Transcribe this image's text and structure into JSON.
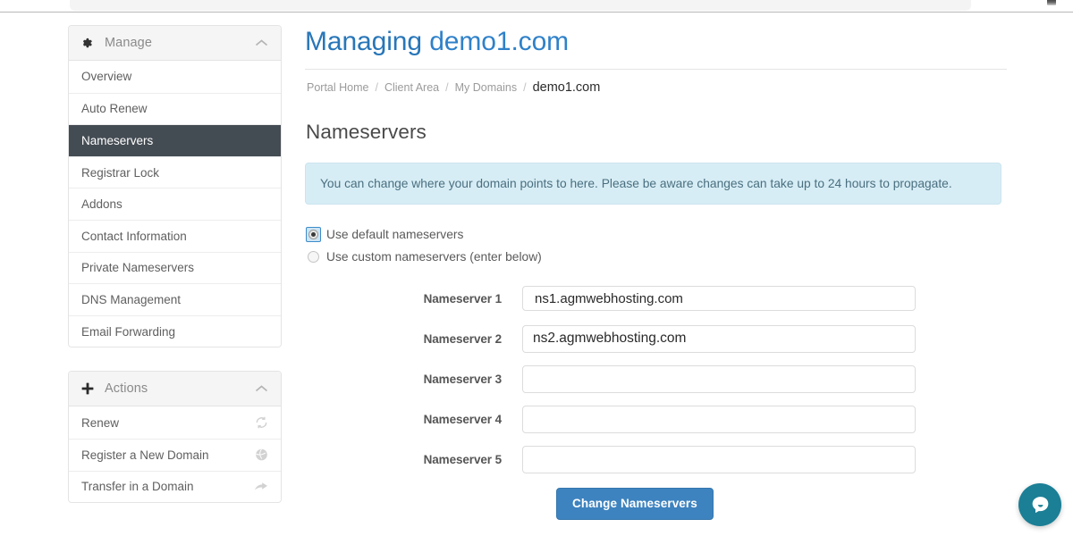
{
  "window": {
    "navbar_remnant": "",
    "top_right_glyph_icon": "cut-off-icon"
  },
  "sidebar": {
    "panels": [
      {
        "title": "Manage",
        "icon": "gear-icon",
        "collapse_icon": "chevron-up-icon",
        "items": [
          {
            "label": "Overview",
            "active": false,
            "icon": ""
          },
          {
            "label": "Auto Renew",
            "active": false,
            "icon": ""
          },
          {
            "label": "Nameservers",
            "active": true,
            "icon": ""
          },
          {
            "label": "Registrar Lock",
            "active": false,
            "icon": ""
          },
          {
            "label": "Addons",
            "active": false,
            "icon": ""
          },
          {
            "label": "Contact Information",
            "active": false,
            "icon": ""
          },
          {
            "label": "Private Nameservers",
            "active": false,
            "icon": ""
          },
          {
            "label": "DNS Management",
            "active": false,
            "icon": ""
          },
          {
            "label": "Email Forwarding",
            "active": false,
            "icon": ""
          }
        ]
      },
      {
        "title": "Actions",
        "icon": "plus-icon",
        "collapse_icon": "chevron-up-icon",
        "items": [
          {
            "label": "Renew",
            "active": false,
            "icon": "refresh-icon"
          },
          {
            "label": "Register a New Domain",
            "active": false,
            "icon": "globe-icon"
          },
          {
            "label": "Transfer in a Domain",
            "active": false,
            "icon": "arrow-right-curve-icon"
          }
        ]
      }
    ]
  },
  "main": {
    "title_prefix": "Managing",
    "title_domain": "demo1.com",
    "breadcrumb": [
      {
        "label": "Portal Home",
        "current": false
      },
      {
        "label": "Client Area",
        "current": false
      },
      {
        "label": "My Domains",
        "current": false
      },
      {
        "label": "demo1.com",
        "current": true
      }
    ],
    "breadcrumb_separator": "/",
    "section_title": "Nameservers",
    "alert_text": "You can change where your domain points to here. Please be aware changes can take up to 24 hours to propagate.",
    "nameserver_mode": {
      "options": [
        {
          "label": "Use default nameservers",
          "selected": true
        },
        {
          "label": "Use custom nameservers (enter below)",
          "selected": false
        }
      ]
    },
    "fields": [
      {
        "label": "Nameserver 1",
        "value": "ns1.agmwebhosting.com",
        "placeholder": ""
      },
      {
        "label": "Nameserver 2",
        "value": "ns2.agmwebhosting.com",
        "placeholder": ""
      },
      {
        "label": "Nameserver 3",
        "value": "",
        "placeholder": ""
      },
      {
        "label": "Nameserver 4",
        "value": "",
        "placeholder": ""
      },
      {
        "label": "Nameserver 5",
        "value": "",
        "placeholder": ""
      }
    ],
    "submit_label": "Change Nameservers"
  },
  "chat": {
    "icon": "chat-bubble-icon",
    "tooltip": ""
  },
  "colors": {
    "title_blue": "#2876b8",
    "sidebar_active": "#444c53",
    "alert_bg": "#d7edf5",
    "alert_text": "#4a6f80",
    "button_blue": "#3d83bf",
    "chat_teal": "#1b7f96"
  }
}
